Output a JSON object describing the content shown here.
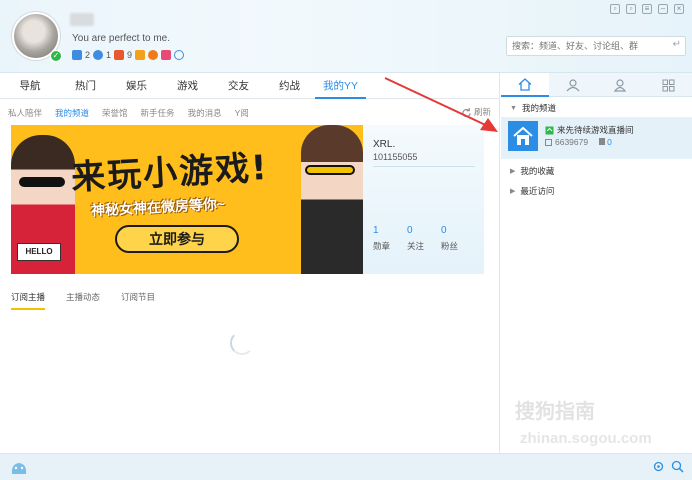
{
  "user": {
    "signature": "You are perfect to me.",
    "badges": [
      {
        "icon": "medal-icon",
        "count": "2",
        "color": "#3d8ee0"
      },
      {
        "icon": "heart-icon",
        "count": "1",
        "color": "#3d8ee0"
      },
      {
        "icon": "level-icon",
        "count": "9",
        "color": "#e8572f"
      },
      {
        "icon": "vip-icon",
        "count": "",
        "color": "#f2a11c"
      },
      {
        "icon": "crown-icon",
        "count": "",
        "color": "#f07a1a"
      },
      {
        "icon": "diamond-icon",
        "count": "",
        "color": "#e84a76"
      },
      {
        "icon": "eye-icon",
        "count": "",
        "color": "#3d8ee0"
      }
    ]
  },
  "search": {
    "placeholder": "搜索：频道、好友、讨论组、群"
  },
  "nav": {
    "items": [
      "导航",
      "热门",
      "娱乐",
      "游戏",
      "交友",
      "约战",
      "我的YY"
    ],
    "active": 6
  },
  "subnav": {
    "items": [
      "私人陪伴",
      "我的频道",
      "荣誉馆",
      "新手任务",
      "我的消息",
      "Y阅"
    ],
    "active": 1,
    "refresh": "刷新"
  },
  "banner": {
    "title": "来玩小游戏!",
    "subtitle": "神秘女神在微房等你~",
    "button": "立即参与",
    "sign": "HELLO"
  },
  "profile": {
    "name": "XRL.",
    "id": "101155055",
    "stats": [
      {
        "value": "1",
        "label": "勋章"
      },
      {
        "value": "0",
        "label": "关注"
      },
      {
        "value": "0",
        "label": "粉丝"
      }
    ]
  },
  "content_tabs": {
    "items": [
      "订阅主播",
      "主播动态",
      "订阅节目"
    ],
    "active": 0
  },
  "side": {
    "tabs": [
      "home-icon",
      "contact-icon",
      "group-icon",
      "apps-icon"
    ],
    "my_channel": "我的频道",
    "channel": {
      "name": "来先待续游戏直播间",
      "id": "6639679",
      "online": "0"
    },
    "my_favorites": "我的收藏",
    "recent": "最近访问"
  },
  "watermark": {
    "line1": "搜狗指南",
    "line2": "zhinan.sogou.com"
  },
  "colors": {
    "accent": "#2b8de4",
    "banner_bg": "#ffbe1c",
    "tab_underline": "#f2c200",
    "arrow": "#e53935"
  }
}
